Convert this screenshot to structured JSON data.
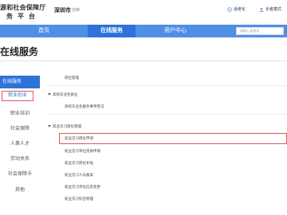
{
  "header": {
    "logo_line1": "源和社会保障厅",
    "logo_line2": "务平台",
    "city": "深圳市",
    "city_switch": "切换",
    "elderly_label": "适老化",
    "login_label": "长者模式"
  },
  "nav": {
    "items": [
      {
        "label": "首页"
      },
      {
        "label": "在线服务"
      },
      {
        "label": "用户中心"
      }
    ],
    "search_placeholder": "请输入关键词"
  },
  "page": {
    "title": "在线服务"
  },
  "sidebar": {
    "heading": "在线服务",
    "items": [
      {
        "label": "就业创业"
      },
      {
        "label": "职业培训"
      },
      {
        "label": "社会保障"
      },
      {
        "label": "人事人才"
      },
      {
        "label": "劳动关系"
      },
      {
        "label": "社会保障卡"
      },
      {
        "label": "其他"
      }
    ]
  },
  "content": {
    "top_item": "岗位管理",
    "section1": {
      "heading": "高校毕业生就业",
      "items": [
        "高校毕业生服务事项登记"
      ]
    },
    "section2": {
      "heading": "就业见习岗位管理",
      "items": [
        "就业见习岗位申请",
        "就业见习单位资质申请",
        "就业见习岗位补贴",
        "就业见习人员备案",
        "就业见习单位信息变更",
        "就业见习综合管理"
      ]
    }
  }
}
